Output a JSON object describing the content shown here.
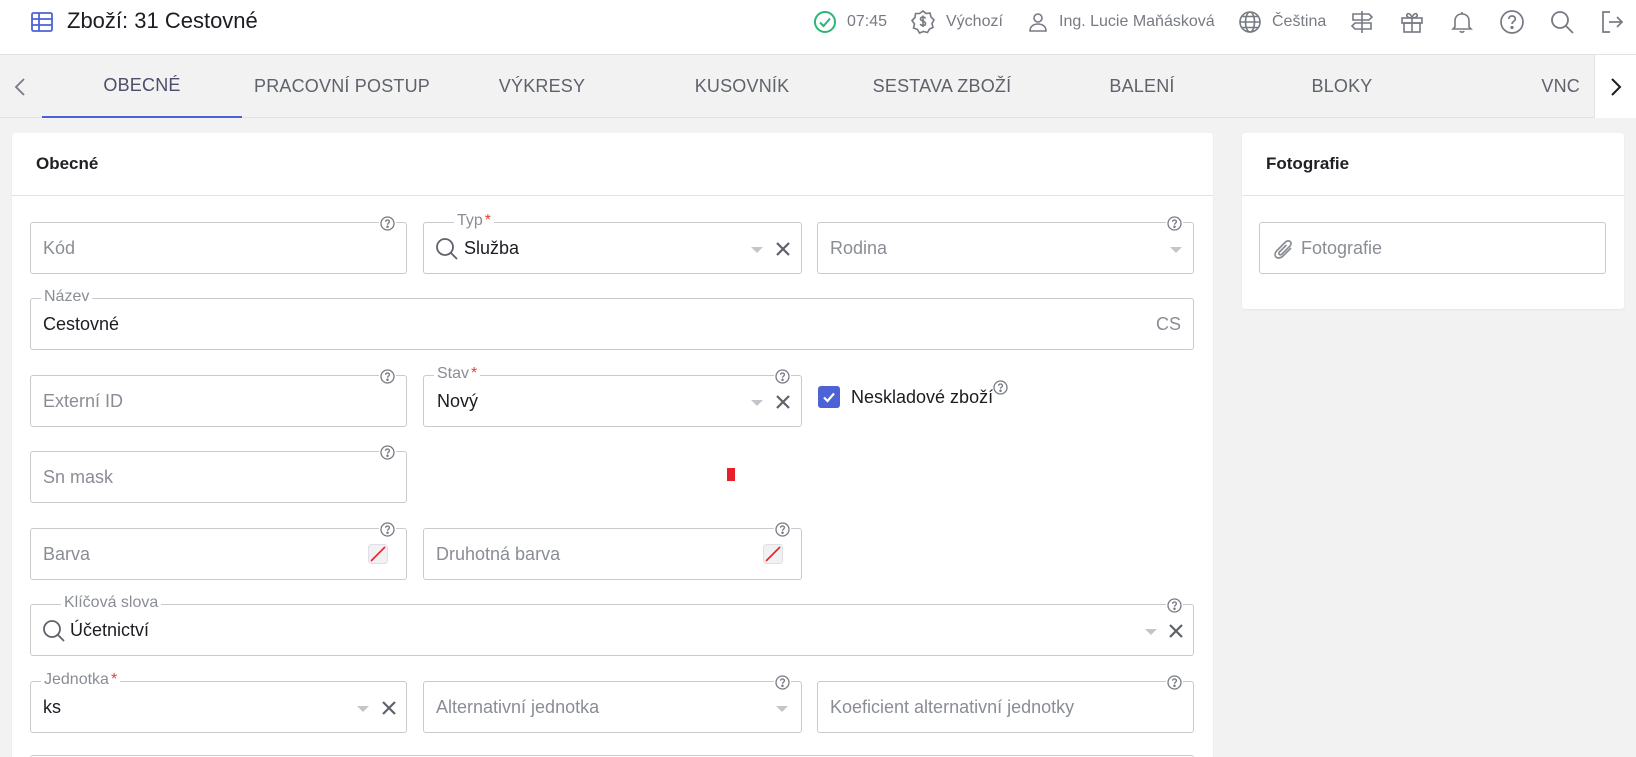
{
  "header": {
    "title": "Zboží: 31 Cestovné",
    "time": "07:45",
    "pricelist": "Výchozí",
    "user": "Ing. Lucie Maňásková",
    "language": "Čeština",
    "accent": "#4b63d6",
    "status_color": "#2bb673"
  },
  "tabs": [
    "OBECNÉ",
    "PRACOVNÍ POSTUP",
    "VÝKRESY",
    "KUSOVNÍK",
    "SESTAVA ZBOŽÍ",
    "BALENÍ",
    "BLOKY",
    "VNC"
  ],
  "general": {
    "title": "Obecné",
    "kod": {
      "placeholder": "Kód"
    },
    "typ": {
      "label": "Typ",
      "required": "*",
      "value": "Služba"
    },
    "rodina": {
      "placeholder": "Rodina"
    },
    "nazev": {
      "label": "Název",
      "value": "Cestovné",
      "lang": "CS"
    },
    "externi_id": {
      "placeholder": "Externí ID"
    },
    "stav": {
      "label": "Stav",
      "required": "*",
      "value": "Nový"
    },
    "neskladove": {
      "label": "Neskladové zboží",
      "checked": true
    },
    "sn_mask": {
      "placeholder": "Sn mask"
    },
    "barva": {
      "placeholder": "Barva"
    },
    "druhotna_barva": {
      "placeholder": "Druhotná barva"
    },
    "klicova_slova": {
      "label": "Klíčová slova",
      "value": "Účetnictví"
    },
    "jednotka": {
      "label": "Jednotka",
      "required": "*",
      "value": "ks"
    },
    "alt_jednotka": {
      "placeholder": "Alternativní jednotka"
    },
    "koef_alt": {
      "placeholder": "Koeficient alternativní jednotky"
    }
  },
  "photos": {
    "title": "Fotografie",
    "upload_placeholder": "Fotografie"
  }
}
